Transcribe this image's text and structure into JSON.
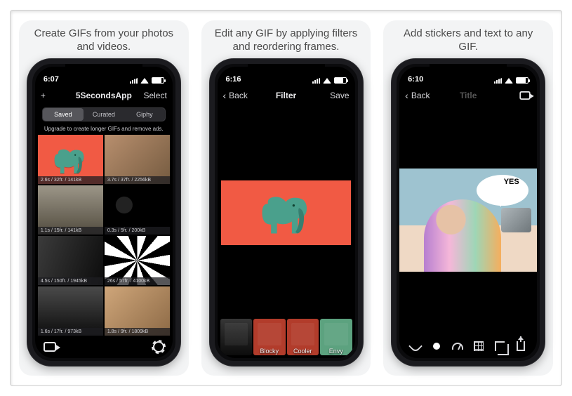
{
  "captions": {
    "s1": "Create GIFs from your photos and videos.",
    "s2": "Edit any GIF by applying filters and reordering frames.",
    "s3": "Add stickers and text to any GIF."
  },
  "screen1": {
    "time": "6:07",
    "nav": {
      "add": "+",
      "title": "5SecondsApp",
      "select": "Select"
    },
    "segments": {
      "saved": "Saved",
      "curated": "Curated",
      "giphy": "Giphy"
    },
    "upgrade_banner": "Upgrade to create longer GIFs and remove ads.",
    "cells": [
      {
        "meta": "2.6s / 32fr. / 141kB"
      },
      {
        "meta": "3.7s / 37fr. / 2256kB"
      },
      {
        "meta": "1.1s / 15fr. / 141kB"
      },
      {
        "meta": "0.3s / 5fr. / 200kB"
      },
      {
        "meta": "4.5s / 150fr. / 1945kB"
      },
      {
        "meta": "26s / 57fr. / 4100kB"
      },
      {
        "meta": "1.6s / 17fr. / 973kB"
      },
      {
        "meta": "1.8s / 9fr. / 1809kB"
      }
    ]
  },
  "screen2": {
    "time": "6:16",
    "nav": {
      "back": "Back",
      "title": "Filter",
      "save": "Save"
    },
    "filters": [
      {
        "label": ""
      },
      {
        "label": "Blocky"
      },
      {
        "label": "Cooler"
      },
      {
        "label": "Envy"
      }
    ]
  },
  "screen3": {
    "time": "6:10",
    "nav": {
      "back": "Back",
      "title": "Title"
    },
    "sticker_text": "YES"
  }
}
